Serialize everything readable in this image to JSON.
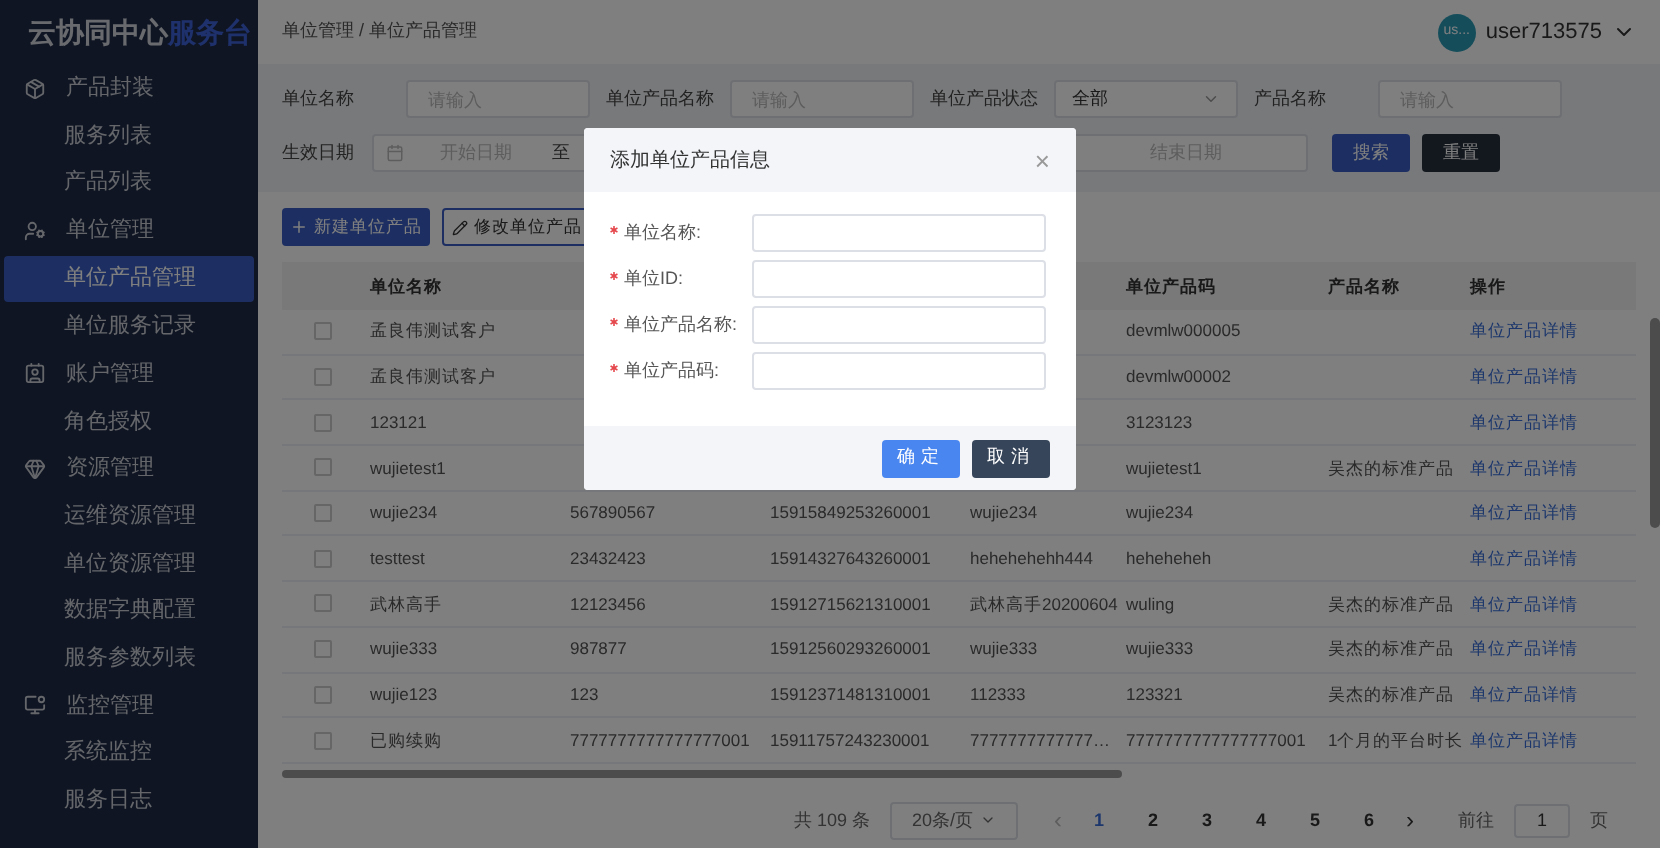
{
  "logo": {
    "text": "云协同中心",
    "accent": "服务台"
  },
  "sidebar": {
    "sections": [
      {
        "label": "产品封装",
        "children": [
          {
            "label": "服务列表",
            "selected": false
          },
          {
            "label": "产品列表",
            "selected": false
          }
        ]
      },
      {
        "label": "单位管理",
        "children": [
          {
            "label": "单位产品管理",
            "selected": true
          },
          {
            "label": "单位服务记录",
            "selected": false
          }
        ]
      },
      {
        "label": "账户管理",
        "children": [
          {
            "label": "角色授权",
            "selected": false
          }
        ]
      },
      {
        "label": "资源管理",
        "children": [
          {
            "label": "运维资源管理",
            "selected": false
          },
          {
            "label": "单位资源管理",
            "selected": false
          },
          {
            "label": "数据字典配置",
            "selected": false
          },
          {
            "label": "服务参数列表",
            "selected": false
          }
        ]
      },
      {
        "label": "监控管理",
        "children": [
          {
            "label": "系统监控",
            "selected": false
          },
          {
            "label": "服务日志",
            "selected": false
          }
        ]
      }
    ]
  },
  "header": {
    "breadcrumb": "单位管理 / 单位产品管理",
    "avatar": "us...",
    "user": "user713575"
  },
  "filters": {
    "row1": [
      {
        "label": "单位名称",
        "kind": "input",
        "placeholder": "请输入"
      },
      {
        "label": "单位产品名称",
        "kind": "input",
        "placeholder": "请输入"
      },
      {
        "label": "单位产品状态",
        "kind": "select",
        "value": "全部"
      },
      {
        "label": "产品名称",
        "kind": "input",
        "placeholder": "请输入"
      }
    ],
    "date": {
      "label": "生效日期",
      "start": "开始日期",
      "separator": "至",
      "end": "结束日期"
    },
    "search": "搜索",
    "reset": "重置"
  },
  "toolbar": {
    "create": "新建单位产品",
    "edit": "修改单位产品"
  },
  "table": {
    "columns": [
      "单位名称",
      null,
      null,
      null,
      "单位产品码",
      "产品名称",
      "操作"
    ],
    "rows": [
      {
        "checked": false,
        "cells": [
          "孟良伟测试客户",
          null,
          null,
          null,
          "devmlw000005",
          null
        ],
        "action": "单位产品详情"
      },
      {
        "checked": false,
        "cells": [
          "孟良伟测试客户",
          null,
          null,
          null,
          "devmlw00002",
          null
        ],
        "action": "单位产品详情"
      },
      {
        "checked": false,
        "cells": [
          "123121",
          null,
          null,
          null,
          "3123123",
          null
        ],
        "action": "单位产品详情"
      },
      {
        "checked": false,
        "cells": [
          "wujietest1",
          null,
          null,
          null,
          "wujietest1",
          "吴杰的标准产品"
        ],
        "action": "单位产品详情"
      },
      {
        "checked": false,
        "cells": [
          "wujie234",
          "567890567",
          "15915849253260001",
          "wujie234",
          "wujie234",
          null
        ],
        "action": "单位产品详情"
      },
      {
        "checked": false,
        "cells": [
          "testtest",
          "23432423",
          "15914327643260001",
          "hehehehehh444",
          "heheheheh",
          null
        ],
        "action": "单位产品详情"
      },
      {
        "checked": false,
        "cells": [
          "武林高手",
          "12123456",
          "15912715621310001",
          "武林高手20200604",
          "wuling",
          "吴杰的标准产品"
        ],
        "action": "单位产品详情"
      },
      {
        "checked": false,
        "cells": [
          "wujie333",
          "987877",
          "15912560293260001",
          "wujie333",
          "wujie333",
          "吴杰的标准产品"
        ],
        "action": "单位产品详情"
      },
      {
        "checked": false,
        "cells": [
          "wujie123",
          "123",
          "15912371481310001",
          "112333",
          "123321",
          "吴杰的标准产品"
        ],
        "action": "单位产品详情"
      },
      {
        "checked": false,
        "cells": [
          "已购续购",
          "7777777777777777001",
          "15911757243230001",
          "7777777777777…",
          "7777777777777777001",
          "1个月的平台时长"
        ],
        "action": "单位产品详情"
      }
    ]
  },
  "pagination": {
    "total": "共 109 条",
    "page_size": "20条/页",
    "prev": "‹",
    "pages": [
      {
        "label": "1",
        "selected": true
      },
      {
        "label": "2",
        "selected": false
      },
      {
        "label": "3",
        "selected": false
      },
      {
        "label": "4",
        "selected": false
      },
      {
        "label": "5",
        "selected": false
      },
      {
        "label": "6",
        "selected": false
      }
    ],
    "next": "›",
    "goto": "前往",
    "goto_value": "1",
    "goto_suffix": "页"
  },
  "dialog": {
    "title": "添加单位产品信息",
    "close": "×",
    "fields": [
      {
        "label": "单位名称:",
        "required": true
      },
      {
        "label": "单位ID:",
        "required": true
      },
      {
        "label": "单位产品名称:",
        "required": true
      },
      {
        "label": "单位产品码:",
        "required": true
      }
    ],
    "ok": "确定",
    "cancel": "取消"
  }
}
